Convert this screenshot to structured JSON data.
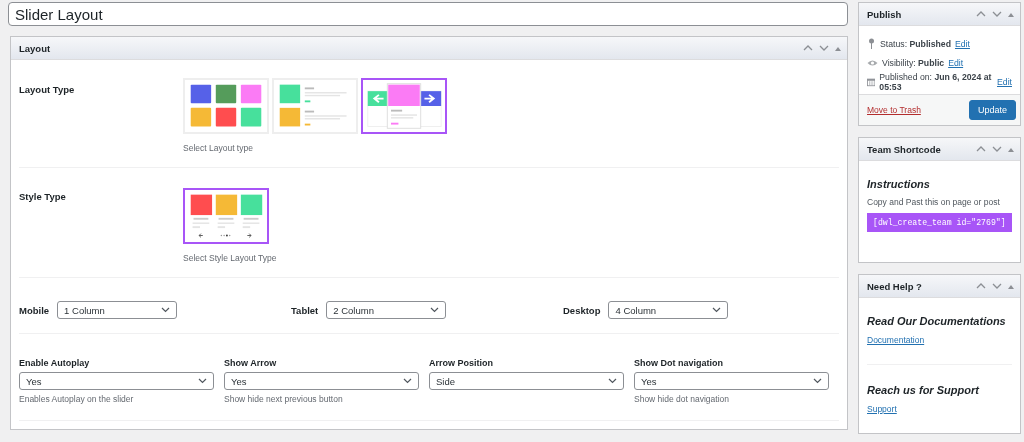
{
  "title_field": {
    "value": "Slider Layout"
  },
  "layout_panel": {
    "title": "Layout",
    "layout_type": {
      "label": "Layout Type",
      "hint": "Select Layout type",
      "options": [
        {
          "kind": "grid",
          "selected": false
        },
        {
          "kind": "list",
          "selected": false
        },
        {
          "kind": "slider",
          "selected": true
        }
      ]
    },
    "style_type": {
      "label": "Style Type",
      "hint": "Select Style Layout Type",
      "options": [
        {
          "kind": "cards",
          "selected": true
        }
      ]
    },
    "columns": [
      {
        "label": "Mobile",
        "value": "1 Column"
      },
      {
        "label": "Tablet",
        "value": "2 Column"
      },
      {
        "label": "Desktop",
        "value": "4 Column"
      }
    ],
    "settings": [
      {
        "label": "Enable Autoplay",
        "value": "Yes",
        "hint": "Enables Autoplay on the slider"
      },
      {
        "label": "Show Arrow",
        "value": "Yes",
        "hint": "Show hide next previous button"
      },
      {
        "label": "Arrow Position",
        "value": "Side"
      },
      {
        "label": "Show Dot navigation",
        "value": "Yes",
        "hint": "Show hide dot navigation"
      }
    ]
  },
  "publish": {
    "title": "Publish",
    "rows": [
      {
        "kind": "status",
        "text": "Status: **Published**",
        "link": "Edit"
      },
      {
        "kind": "visibility",
        "text": "Visibility: **Public**",
        "link": "Edit"
      },
      {
        "kind": "date",
        "text": "Published on: **Jun 6, 2024 at 05:53**",
        "link": "Edit"
      }
    ],
    "trash": "Move to Trash",
    "update": "Update"
  },
  "shortcode": {
    "title": "Team Shortcode",
    "heading": "Instructions",
    "text": "Copy and Past this on page or post",
    "code": "[dwl_create_team id=\"2769\"]"
  },
  "help": {
    "title": "Need Help ?",
    "sections": [
      {
        "heading": "Read Our Documentations",
        "link": "Documentation"
      },
      {
        "heading": "Reach us for Support",
        "link": "Support"
      }
    ]
  }
}
